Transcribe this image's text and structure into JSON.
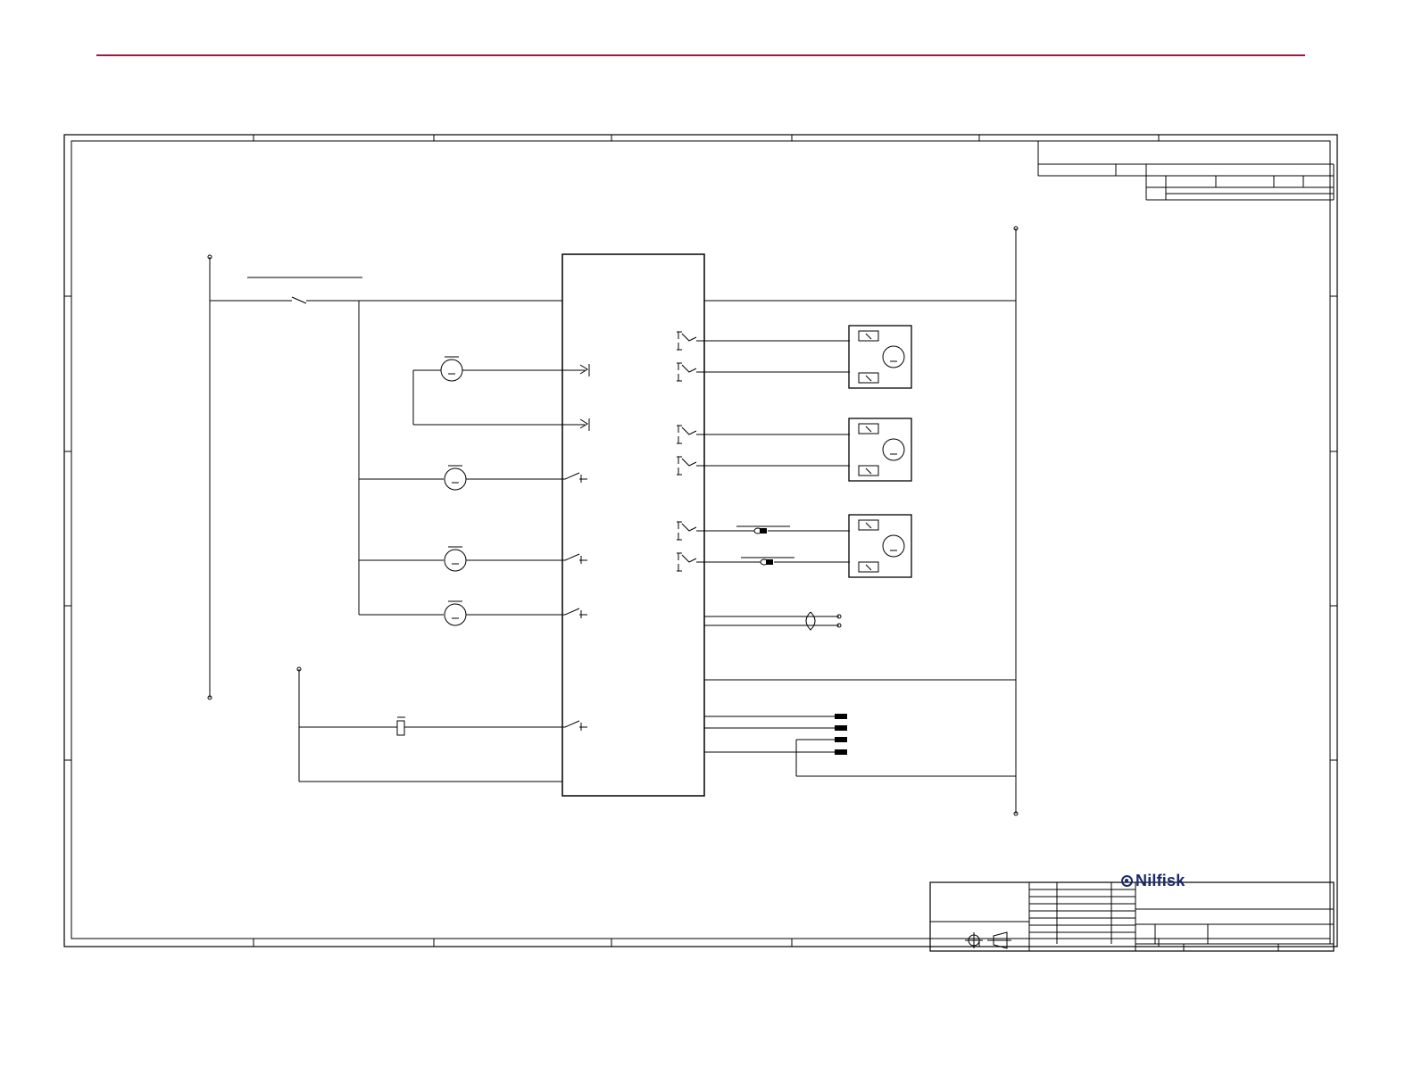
{
  "header": {
    "rule_color": "#b01040"
  },
  "title_block": {
    "brand_name": "Nilfisk",
    "brand_color": "#1a2a6b"
  },
  "symbols": {
    "motors": [
      "motor-symbol",
      "motor-symbol",
      "motor-symbol",
      "motor-symbol"
    ],
    "actuators": [
      "actuator-box-1",
      "actuator-box-2",
      "actuator-box-3"
    ],
    "connectors": [
      "connector-pin",
      "connector-pin",
      "connector-pin",
      "connector-pin"
    ],
    "projection_icons": [
      "first-angle-projection-icon"
    ]
  }
}
